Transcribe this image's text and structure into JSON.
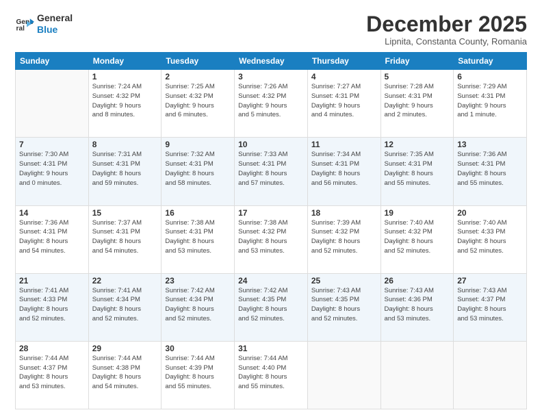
{
  "logo": {
    "line1": "General",
    "line2": "Blue"
  },
  "title": "December 2025",
  "subtitle": "Lipnita, Constanta County, Romania",
  "weekdays": [
    "Sunday",
    "Monday",
    "Tuesday",
    "Wednesday",
    "Thursday",
    "Friday",
    "Saturday"
  ],
  "weeks": [
    [
      {
        "day": "",
        "info": ""
      },
      {
        "day": "1",
        "info": "Sunrise: 7:24 AM\nSunset: 4:32 PM\nDaylight: 9 hours\nand 8 minutes."
      },
      {
        "day": "2",
        "info": "Sunrise: 7:25 AM\nSunset: 4:32 PM\nDaylight: 9 hours\nand 6 minutes."
      },
      {
        "day": "3",
        "info": "Sunrise: 7:26 AM\nSunset: 4:32 PM\nDaylight: 9 hours\nand 5 minutes."
      },
      {
        "day": "4",
        "info": "Sunrise: 7:27 AM\nSunset: 4:31 PM\nDaylight: 9 hours\nand 4 minutes."
      },
      {
        "day": "5",
        "info": "Sunrise: 7:28 AM\nSunset: 4:31 PM\nDaylight: 9 hours\nand 2 minutes."
      },
      {
        "day": "6",
        "info": "Sunrise: 7:29 AM\nSunset: 4:31 PM\nDaylight: 9 hours\nand 1 minute."
      }
    ],
    [
      {
        "day": "7",
        "info": "Sunrise: 7:30 AM\nSunset: 4:31 PM\nDaylight: 9 hours\nand 0 minutes."
      },
      {
        "day": "8",
        "info": "Sunrise: 7:31 AM\nSunset: 4:31 PM\nDaylight: 8 hours\nand 59 minutes."
      },
      {
        "day": "9",
        "info": "Sunrise: 7:32 AM\nSunset: 4:31 PM\nDaylight: 8 hours\nand 58 minutes."
      },
      {
        "day": "10",
        "info": "Sunrise: 7:33 AM\nSunset: 4:31 PM\nDaylight: 8 hours\nand 57 minutes."
      },
      {
        "day": "11",
        "info": "Sunrise: 7:34 AM\nSunset: 4:31 PM\nDaylight: 8 hours\nand 56 minutes."
      },
      {
        "day": "12",
        "info": "Sunrise: 7:35 AM\nSunset: 4:31 PM\nDaylight: 8 hours\nand 55 minutes."
      },
      {
        "day": "13",
        "info": "Sunrise: 7:36 AM\nSunset: 4:31 PM\nDaylight: 8 hours\nand 55 minutes."
      }
    ],
    [
      {
        "day": "14",
        "info": "Sunrise: 7:36 AM\nSunset: 4:31 PM\nDaylight: 8 hours\nand 54 minutes."
      },
      {
        "day": "15",
        "info": "Sunrise: 7:37 AM\nSunset: 4:31 PM\nDaylight: 8 hours\nand 54 minutes."
      },
      {
        "day": "16",
        "info": "Sunrise: 7:38 AM\nSunset: 4:31 PM\nDaylight: 8 hours\nand 53 minutes."
      },
      {
        "day": "17",
        "info": "Sunrise: 7:38 AM\nSunset: 4:32 PM\nDaylight: 8 hours\nand 53 minutes."
      },
      {
        "day": "18",
        "info": "Sunrise: 7:39 AM\nSunset: 4:32 PM\nDaylight: 8 hours\nand 52 minutes."
      },
      {
        "day": "19",
        "info": "Sunrise: 7:40 AM\nSunset: 4:32 PM\nDaylight: 8 hours\nand 52 minutes."
      },
      {
        "day": "20",
        "info": "Sunrise: 7:40 AM\nSunset: 4:33 PM\nDaylight: 8 hours\nand 52 minutes."
      }
    ],
    [
      {
        "day": "21",
        "info": "Sunrise: 7:41 AM\nSunset: 4:33 PM\nDaylight: 8 hours\nand 52 minutes."
      },
      {
        "day": "22",
        "info": "Sunrise: 7:41 AM\nSunset: 4:34 PM\nDaylight: 8 hours\nand 52 minutes."
      },
      {
        "day": "23",
        "info": "Sunrise: 7:42 AM\nSunset: 4:34 PM\nDaylight: 8 hours\nand 52 minutes."
      },
      {
        "day": "24",
        "info": "Sunrise: 7:42 AM\nSunset: 4:35 PM\nDaylight: 8 hours\nand 52 minutes."
      },
      {
        "day": "25",
        "info": "Sunrise: 7:43 AM\nSunset: 4:35 PM\nDaylight: 8 hours\nand 52 minutes."
      },
      {
        "day": "26",
        "info": "Sunrise: 7:43 AM\nSunset: 4:36 PM\nDaylight: 8 hours\nand 53 minutes."
      },
      {
        "day": "27",
        "info": "Sunrise: 7:43 AM\nSunset: 4:37 PM\nDaylight: 8 hours\nand 53 minutes."
      }
    ],
    [
      {
        "day": "28",
        "info": "Sunrise: 7:44 AM\nSunset: 4:37 PM\nDaylight: 8 hours\nand 53 minutes."
      },
      {
        "day": "29",
        "info": "Sunrise: 7:44 AM\nSunset: 4:38 PM\nDaylight: 8 hours\nand 54 minutes."
      },
      {
        "day": "30",
        "info": "Sunrise: 7:44 AM\nSunset: 4:39 PM\nDaylight: 8 hours\nand 55 minutes."
      },
      {
        "day": "31",
        "info": "Sunrise: 7:44 AM\nSunset: 4:40 PM\nDaylight: 8 hours\nand 55 minutes."
      },
      {
        "day": "",
        "info": ""
      },
      {
        "day": "",
        "info": ""
      },
      {
        "day": "",
        "info": ""
      }
    ]
  ]
}
